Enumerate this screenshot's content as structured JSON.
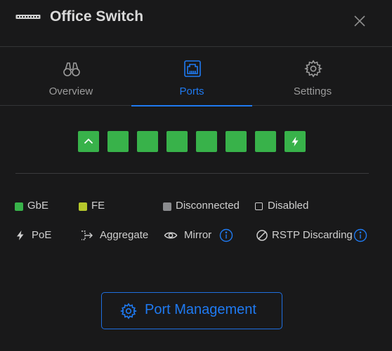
{
  "header": {
    "title": "Office Switch",
    "device_icon": "switch-device-icon",
    "close_icon": "close-icon"
  },
  "tabs": [
    {
      "label": "Overview",
      "icon": "binoculars-icon",
      "active": false
    },
    {
      "label": "Ports",
      "icon": "ethernet-port-icon",
      "active": true
    },
    {
      "label": "Settings",
      "icon": "gear-icon",
      "active": false
    }
  ],
  "ports": [
    {
      "status": "GbE",
      "uplink": true,
      "poe": false
    },
    {
      "status": "GbE",
      "uplink": false,
      "poe": false
    },
    {
      "status": "GbE",
      "uplink": false,
      "poe": false
    },
    {
      "status": "GbE",
      "uplink": false,
      "poe": false
    },
    {
      "status": "GbE",
      "uplink": false,
      "poe": false
    },
    {
      "status": "GbE",
      "uplink": false,
      "poe": false
    },
    {
      "status": "GbE",
      "uplink": false,
      "poe": false
    },
    {
      "status": "GbE",
      "uplink": false,
      "poe": true
    }
  ],
  "legend": {
    "speed": {
      "gbe": "GbE",
      "fe": "FE",
      "disconnected": "Disconnected",
      "disabled": "Disabled"
    },
    "features": {
      "poe": "PoE",
      "aggregate": "Aggregate",
      "mirror": "Mirror",
      "rstp": "RSTP Discarding"
    }
  },
  "colors": {
    "accent": "#1f7af1",
    "gbe": "#38b24a",
    "fe": "#b5c72b",
    "disconnected": "#8a8b8e",
    "background": "#19191a"
  },
  "actions": {
    "port_management": "Port Management"
  }
}
